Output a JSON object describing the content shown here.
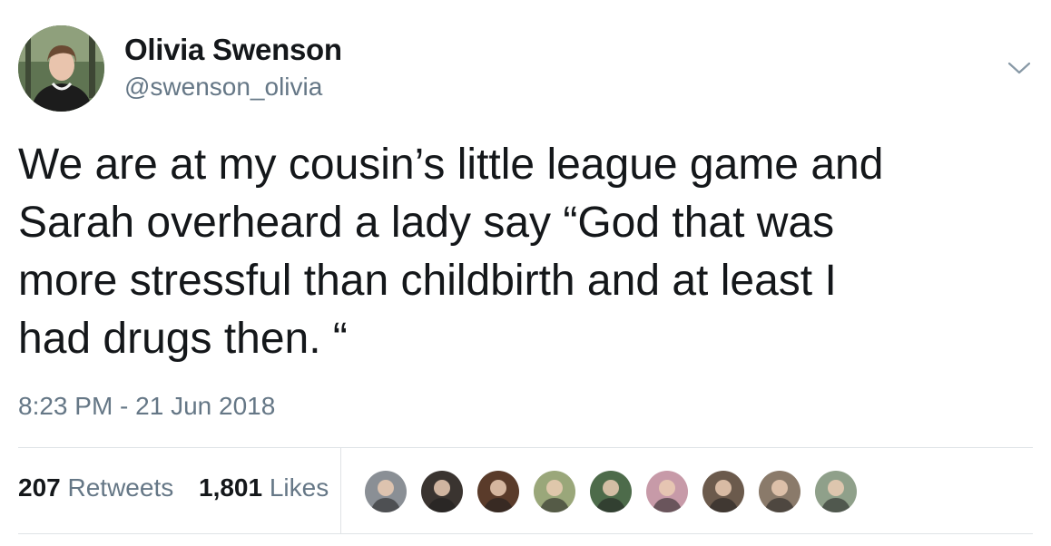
{
  "author": {
    "display_name": "Olivia Swenson",
    "handle": "@swenson_olivia",
    "avatar_icon": "profile-photo"
  },
  "tweet": {
    "text": "We are at my cousin’s little league game and\nSarah overheard a lady say “God that was\nmore stressful than childbirth and at least I\nhad drugs then. “",
    "timestamp": "8:23 PM - 21 Jun 2018"
  },
  "stats": {
    "retweets_count": "207",
    "retweets_label": "Retweets",
    "likes_count": "1,801",
    "likes_label": "Likes"
  },
  "likers": [
    {
      "icon": "liker-avatar",
      "color": "#8a8f95"
    },
    {
      "icon": "liker-avatar",
      "color": "#3a3430"
    },
    {
      "icon": "liker-avatar",
      "color": "#5a3b2a"
    },
    {
      "icon": "liker-avatar",
      "color": "#9aa77a"
    },
    {
      "icon": "liker-avatar",
      "color": "#4d6b4a"
    },
    {
      "icon": "liker-avatar",
      "color": "#c79aa8"
    },
    {
      "icon": "liker-avatar",
      "color": "#6b5a4c"
    },
    {
      "icon": "liker-avatar",
      "color": "#8a7a6a"
    },
    {
      "icon": "liker-avatar",
      "color": "#8fa08a"
    }
  ],
  "colors": {
    "text_primary": "#14171a",
    "text_secondary": "#657786",
    "divider": "#dfe3e6"
  }
}
